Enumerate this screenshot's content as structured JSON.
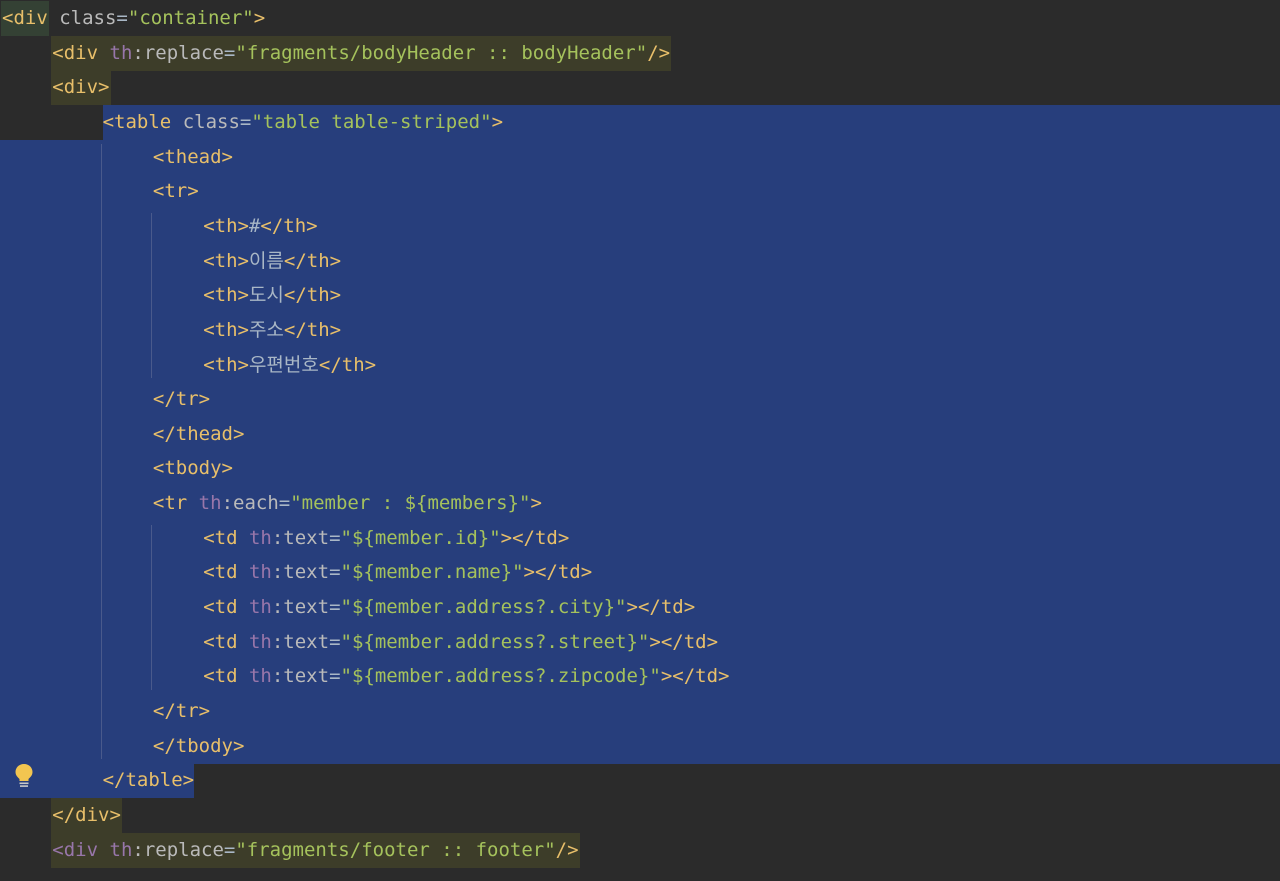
{
  "editor": {
    "colors": {
      "background": "#2b2b2b",
      "selection": "#273e7c",
      "tag_highlight": "#3d3d29",
      "tag": "#e8bf6a",
      "attribute": "#bababa",
      "namespace": "#9876aa",
      "string": "#a5c25c",
      "text": "#a9b7c6"
    },
    "lines": [
      {
        "indent": 0,
        "tokens": [
          [
            "tag",
            "<div"
          ],
          [
            "text",
            " "
          ],
          [
            "attr",
            "class"
          ],
          [
            "text",
            "="
          ],
          [
            "str",
            "\"container\""
          ],
          [
            "tag",
            ">"
          ]
        ]
      },
      {
        "indent": 1,
        "tokens": [
          [
            "tag",
            "<div"
          ],
          [
            "text",
            " "
          ],
          [
            "ns",
            "th"
          ],
          [
            "attr",
            ":replace"
          ],
          [
            "text",
            "="
          ],
          [
            "str",
            "\"fragments/bodyHeader :: bodyHeader\""
          ],
          [
            "tag",
            "/>"
          ]
        ]
      },
      {
        "indent": 1,
        "tokens": [
          [
            "tag",
            "<div>"
          ]
        ]
      },
      {
        "indent": 2,
        "tokens": [
          [
            "tag",
            "<table"
          ],
          [
            "text",
            " "
          ],
          [
            "attr",
            "class"
          ],
          [
            "text",
            "="
          ],
          [
            "str",
            "\"table table-striped\""
          ],
          [
            "tag",
            ">"
          ]
        ]
      },
      {
        "indent": 3,
        "tokens": [
          [
            "tag",
            "<thead>"
          ]
        ]
      },
      {
        "indent": 3,
        "tokens": [
          [
            "tag",
            "<tr>"
          ]
        ]
      },
      {
        "indent": 4,
        "tokens": [
          [
            "tag",
            "<th>"
          ],
          [
            "text",
            "#"
          ],
          [
            "tag",
            "</th>"
          ]
        ]
      },
      {
        "indent": 4,
        "tokens": [
          [
            "tag",
            "<th>"
          ],
          [
            "text",
            "이름"
          ],
          [
            "tag",
            "</th>"
          ]
        ]
      },
      {
        "indent": 4,
        "tokens": [
          [
            "tag",
            "<th>"
          ],
          [
            "text",
            "도시"
          ],
          [
            "tag",
            "</th>"
          ]
        ]
      },
      {
        "indent": 4,
        "tokens": [
          [
            "tag",
            "<th>"
          ],
          [
            "text",
            "주소"
          ],
          [
            "tag",
            "</th>"
          ]
        ]
      },
      {
        "indent": 4,
        "tokens": [
          [
            "tag",
            "<th>"
          ],
          [
            "text",
            "우편번호"
          ],
          [
            "tag",
            "</th>"
          ]
        ]
      },
      {
        "indent": 3,
        "tokens": [
          [
            "tag",
            "</tr>"
          ]
        ]
      },
      {
        "indent": 3,
        "tokens": [
          [
            "tag",
            "</thead>"
          ]
        ]
      },
      {
        "indent": 3,
        "tokens": [
          [
            "tag",
            "<tbody>"
          ]
        ]
      },
      {
        "indent": 3,
        "tokens": [
          [
            "tag",
            "<tr"
          ],
          [
            "text",
            " "
          ],
          [
            "ns",
            "th"
          ],
          [
            "attr",
            ":each"
          ],
          [
            "text",
            "="
          ],
          [
            "str",
            "\"member : ${members}\""
          ],
          [
            "tag",
            ">"
          ]
        ]
      },
      {
        "indent": 4,
        "tokens": [
          [
            "tag",
            "<td"
          ],
          [
            "text",
            " "
          ],
          [
            "ns",
            "th"
          ],
          [
            "attr",
            ":text"
          ],
          [
            "text",
            "="
          ],
          [
            "str",
            "\"${member.id}\""
          ],
          [
            "tag",
            "></td>"
          ]
        ]
      },
      {
        "indent": 4,
        "tokens": [
          [
            "tag",
            "<td"
          ],
          [
            "text",
            " "
          ],
          [
            "ns",
            "th"
          ],
          [
            "attr",
            ":text"
          ],
          [
            "text",
            "="
          ],
          [
            "str",
            "\"${member.name}\""
          ],
          [
            "tag",
            "></td>"
          ]
        ]
      },
      {
        "indent": 4,
        "tokens": [
          [
            "tag",
            "<td"
          ],
          [
            "text",
            " "
          ],
          [
            "ns",
            "th"
          ],
          [
            "attr",
            ":text"
          ],
          [
            "text",
            "="
          ],
          [
            "str",
            "\"${member.address?.city}\""
          ],
          [
            "tag",
            "></td>"
          ]
        ]
      },
      {
        "indent": 4,
        "tokens": [
          [
            "tag",
            "<td"
          ],
          [
            "text",
            " "
          ],
          [
            "ns",
            "th"
          ],
          [
            "attr",
            ":text"
          ],
          [
            "text",
            "="
          ],
          [
            "str",
            "\"${member.address?.street}\""
          ],
          [
            "tag",
            "></td>"
          ]
        ]
      },
      {
        "indent": 4,
        "tokens": [
          [
            "tag",
            "<td"
          ],
          [
            "text",
            " "
          ],
          [
            "ns",
            "th"
          ],
          [
            "attr",
            ":text"
          ],
          [
            "text",
            "="
          ],
          [
            "str",
            "\"${member.address?.zipcode}\""
          ],
          [
            "tag",
            "></td>"
          ]
        ]
      },
      {
        "indent": 3,
        "tokens": [
          [
            "tag",
            "</tr>"
          ]
        ]
      },
      {
        "indent": 3,
        "tokens": [
          [
            "tag",
            "</tbody>"
          ]
        ]
      },
      {
        "indent": 2,
        "tokens": [
          [
            "tag",
            "</table>"
          ]
        ]
      },
      {
        "indent": 1,
        "tokens": [
          [
            "tag",
            "</div>"
          ]
        ]
      },
      {
        "indent": 1,
        "tokens": [
          [
            "ns",
            "<div "
          ],
          [
            "ns",
            "th"
          ],
          [
            "attr",
            ":replace"
          ],
          [
            "text",
            "="
          ],
          [
            "str",
            "\"fragments/footer :: footer\""
          ],
          [
            "tag",
            "/>"
          ]
        ]
      }
    ],
    "intention_icon": "lightbulb-icon"
  }
}
